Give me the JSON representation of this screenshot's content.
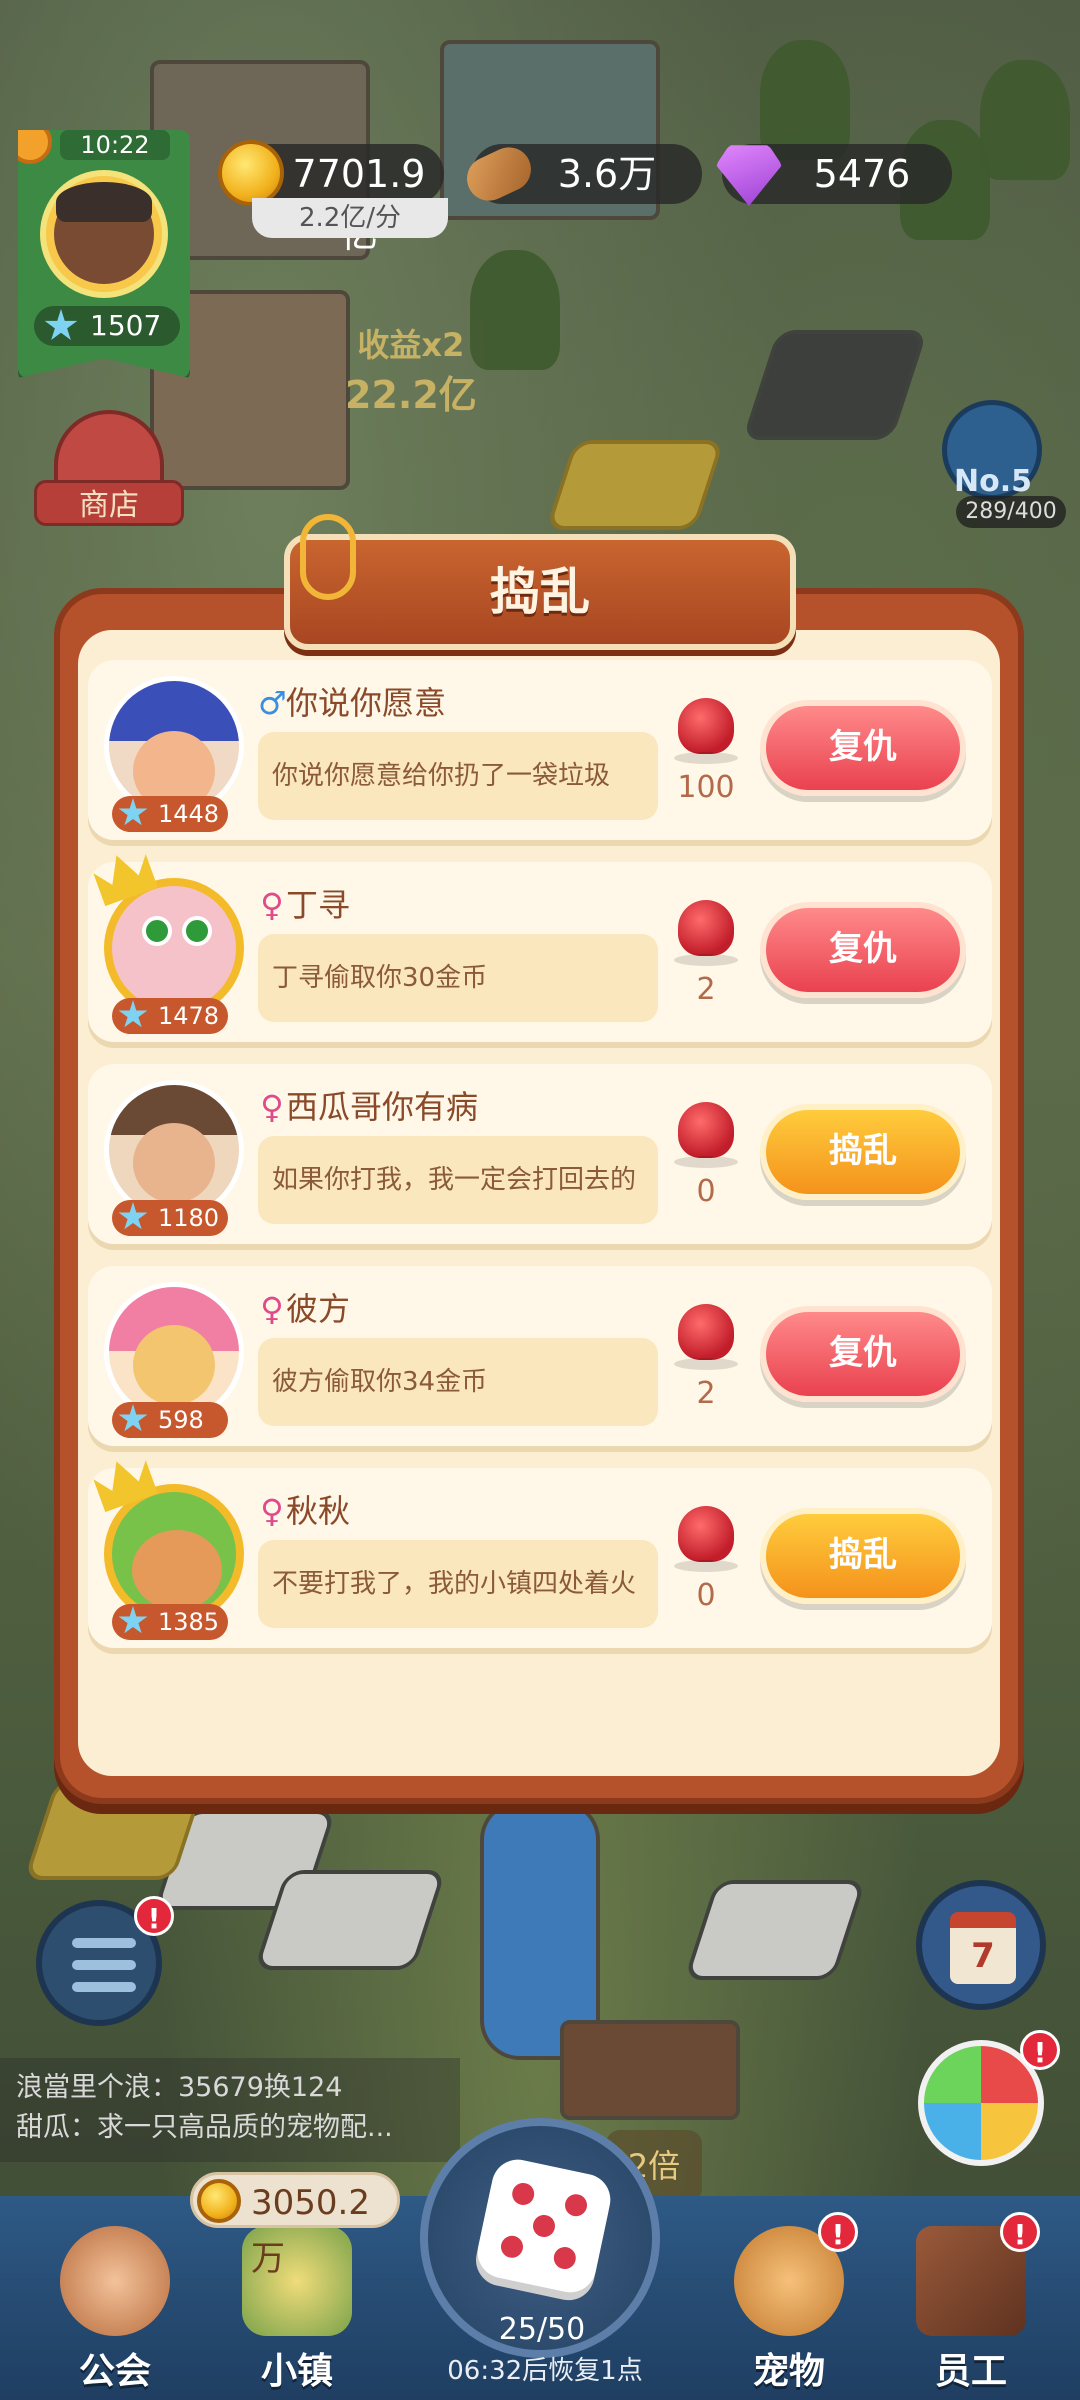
{
  "hud": {
    "time": "10:22",
    "player_level": "1507",
    "coins": "7701.9亿",
    "coin_rate": "2.2亿/分",
    "wood": "3.6万",
    "gems": "5476"
  },
  "map": {
    "bonus_label": "收益x2",
    "bonus_value": "22.2亿",
    "shop_label": "商店",
    "rank_label": "No.5",
    "rank_progress": "289/400"
  },
  "dialog": {
    "title": "捣乱",
    "rows": [
      {
        "gender": "♂",
        "name": "你说你愿意",
        "level": "1448",
        "message": "你说你愿意给你扔了一袋垃圾",
        "attacks": "100",
        "action": "复仇",
        "action_style": "red"
      },
      {
        "gender": "♀",
        "name": "丁寻",
        "level": "1478",
        "message": "丁寻偷取你30金币",
        "attacks": "2",
        "action": "复仇",
        "action_style": "red"
      },
      {
        "gender": "♀",
        "name": "西瓜哥你有病",
        "level": "1180",
        "message": "如果你打我，我一定会打回去的",
        "attacks": "0",
        "action": "捣乱",
        "action_style": "orange"
      },
      {
        "gender": "♀",
        "name": "彼方",
        "level": "598",
        "message": "彼方偷取你34金币",
        "attacks": "2",
        "action": "复仇",
        "action_style": "red"
      },
      {
        "gender": "♀",
        "name": "秋秋",
        "level": "1385",
        "message": "不要打我了，我的小镇四处着火",
        "attacks": "0",
        "action": "捣乱",
        "action_style": "orange"
      }
    ]
  },
  "chat": {
    "line1": "浪當里个浪：35679换124",
    "line2": "甜瓜：求一只高品质的宠物配..."
  },
  "bottom": {
    "bonus_multiplier": "2倍",
    "town_gold": "3050.2万",
    "dice_count": "25/50",
    "recover_text": "06:32后恢复1点",
    "tabs": [
      "公会",
      "小镇",
      "宠物",
      "员工"
    ],
    "alert": "!",
    "calendar_day": "7"
  }
}
